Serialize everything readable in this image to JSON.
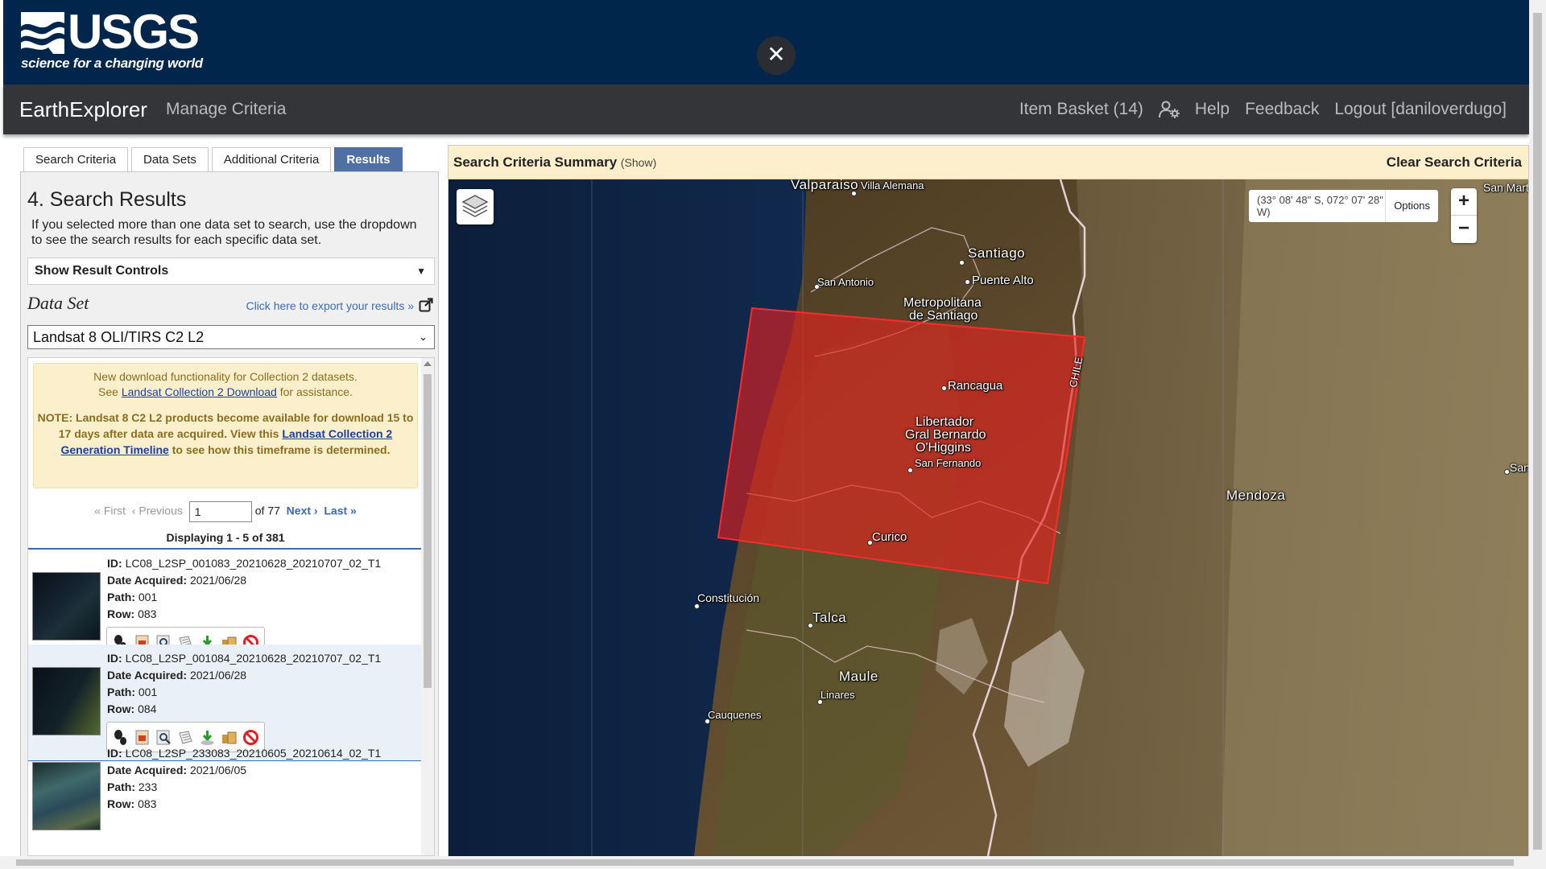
{
  "banner": {
    "logo_word": "USGS",
    "logo_tagline": "science for a changing world",
    "close_symbol": "✕"
  },
  "nav": {
    "brand": "EarthExplorer",
    "manage": "Manage Criteria",
    "basket": "Item Basket (14)",
    "user_icon": "user-gear-icon",
    "help": "Help",
    "feedback": "Feedback",
    "logout": "Logout [daniloverdugo]"
  },
  "tabs": [
    "Search Criteria",
    "Data Sets",
    "Additional Criteria",
    "Results"
  ],
  "results": {
    "title": "4. Search Results",
    "description": "If you selected more than one data set to search, use the dropdown to see the search results for each specific data set.",
    "controls_label": "Show Result Controls",
    "dataset_label": "Data Set",
    "export_link": "Click here to export your results »",
    "dataset_value": "Landsat 8 OLI/TIRS C2 L2",
    "notice_line1": "New download functionality for Collection 2 datasets.",
    "notice_see": "See",
    "notice_link1": "Landsat Collection 2 Download",
    "notice_after1": "for assistance.",
    "note_text1": "NOTE: Landsat 8 C2 L2 products become available for download 15 to 17 days after data are acquired. View this",
    "note_link": "Landsat Collection 2 Generation Timeline",
    "note_text2": "to see how this timeframe is determined.",
    "pager": {
      "first": "« First",
      "previous": "‹ Previous",
      "page_value": "1",
      "of_text": "of 77",
      "next": "Next ›",
      "last": "Last »"
    },
    "displaying": "Displaying 1 - 5 of 381",
    "labels": {
      "id": "ID:",
      "date": "Date Acquired:",
      "path": "Path:",
      "row": "Row:"
    },
    "items": [
      {
        "id": "LC08_L2SP_001083_20210628_20210707_02_T1",
        "date": "2021/06/28",
        "path": "001",
        "row": "083"
      },
      {
        "id": "LC08_L2SP_001084_20210628_20210707_02_T1",
        "date": "2021/06/28",
        "path": "001",
        "row": "084"
      },
      {
        "id": "LC08_L2SP_233083_20210605_20210614_02_T1",
        "date": "2021/06/05",
        "path": "233",
        "row": "083"
      }
    ],
    "action_icons": [
      "footprint-icon",
      "overlay-icon",
      "compare-icon",
      "metadata-icon",
      "download-icon",
      "order-icon",
      "exclude-icon"
    ]
  },
  "map": {
    "criteria_title": "Search Criteria Summary",
    "criteria_show": "(Show)",
    "clear": "Clear Search Criteria",
    "coords": "(33° 08' 48\" S, 072° 07' 28\" W)",
    "options": "Options",
    "zoom_in": "+",
    "zoom_out": "−",
    "footprint_color": "#e8201f",
    "labels": {
      "valparaiso": "Valparaiso",
      "villa_alemana": "Villa Alemana",
      "santiago": "Santiago",
      "puente_alto": "Puente Alto",
      "san_antonio": "San Antonio",
      "metropolitana_1": "Metropolitana",
      "metropolitana_2": "de Santiago",
      "rancagua": "Rancagua",
      "libertador_1": "Libertador",
      "libertador_2": "Gral Bernardo",
      "libertador_3": "O'Higgins",
      "san_fernando": "San Fernando",
      "curico": "Curico",
      "constitucion": "Constitución",
      "talca": "Talca",
      "maule": "Maule",
      "linares": "Linares",
      "cauquenes": "Cauquenes",
      "mendoza": "Mendoza",
      "chile": "CHILE",
      "san_martin": "San Mart",
      "san_right": "San"
    }
  }
}
